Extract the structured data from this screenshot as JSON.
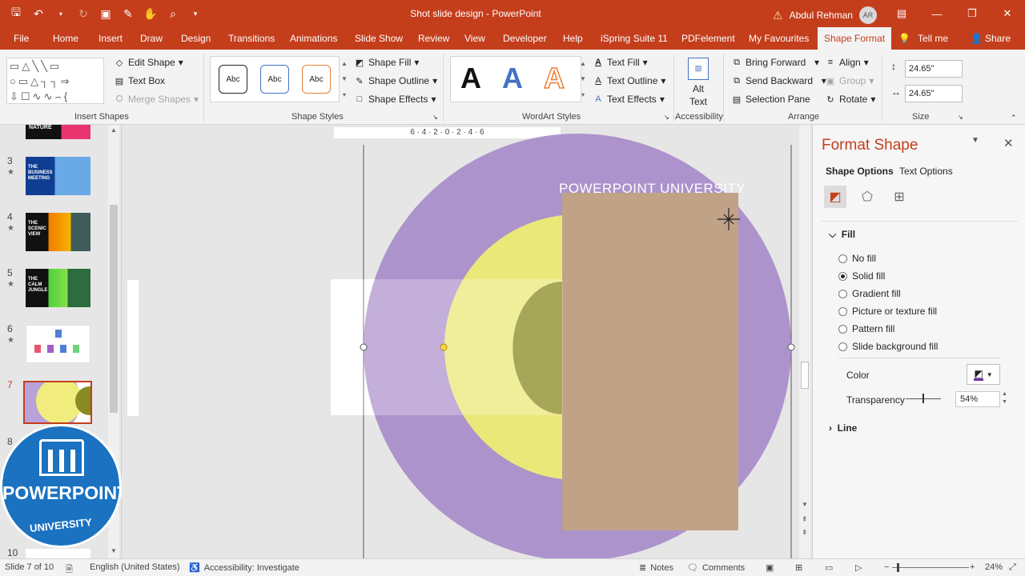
{
  "app": {
    "title": "Shot slide design  -  PowerPoint",
    "user_name": "Abdul Rehman",
    "user_initials": "AR",
    "accent": "#c43e1c"
  },
  "tabs": [
    "File",
    "Home",
    "Insert",
    "Draw",
    "Design",
    "Transitions",
    "Animations",
    "Slide Show",
    "Review",
    "View",
    "Developer",
    "Help",
    "iSpring Suite 11",
    "PDFelement",
    "My Favourites",
    "Shape Format",
    "Tell me",
    "Share"
  ],
  "ribbon": {
    "insert_shapes": {
      "label": "Insert Shapes",
      "edit_shape": "Edit Shape",
      "text_box": "Text Box",
      "merge_shapes": "Merge Shapes"
    },
    "shape_styles": {
      "label": "Shape Styles",
      "sample": "Abc",
      "fill": "Shape Fill",
      "outline": "Shape Outline",
      "effects": "Shape Effects"
    },
    "wordart_styles": {
      "label": "WordArt Styles",
      "sample": "A",
      "text_fill": "Text Fill",
      "text_outline": "Text Outline",
      "text_effects": "Text Effects"
    },
    "accessibility": {
      "label": "Accessibility",
      "alt_text_1": "Alt",
      "alt_text_2": "Text"
    },
    "arrange": {
      "label": "Arrange",
      "bring_forward": "Bring Forward",
      "send_backward": "Send Backward",
      "selection_pane": "Selection Pane",
      "align": "Align",
      "group": "Group",
      "rotate": "Rotate"
    },
    "size": {
      "label": "Size",
      "height": "24.65\"",
      "width": "24.65\""
    }
  },
  "slides": {
    "numbers": [
      "3",
      "4",
      "5",
      "6",
      "7",
      "8",
      "10"
    ],
    "thumb_titles": [
      "THE BUSINESS MEETING",
      "THE SCENIC VIEW",
      "THE CALM JUNGLE"
    ],
    "top_thumb_text": "NATURE"
  },
  "slide": {
    "watermark": "POWERPOINT UNIVERSITY",
    "ruler_h": "6 · 4 · 2 · 0 · 2 · 4 · 6",
    "colors": {
      "purple": "#a68ac8",
      "yellow": "#ebe87a",
      "olive": "#8a8a23",
      "tan": "#b8958a"
    }
  },
  "logo": {
    "title": "POWERPOINT",
    "subtitle": "UNIVERSITY"
  },
  "format_pane": {
    "title": "Format Shape",
    "shape_options": "Shape Options",
    "text_options": "Text Options",
    "fill_section": "Fill",
    "fill_options": [
      "No fill",
      "Solid fill",
      "Gradient fill",
      "Picture or texture fill",
      "Pattern fill",
      "Slide background fill"
    ],
    "selected_fill": "Solid fill",
    "color_label": "Color",
    "transparency_label": "Transparency",
    "transparency_value": "54%",
    "transparency_fraction": 0.54,
    "line_section": "Line"
  },
  "status": {
    "slide_info": "Slide 7 of 10",
    "language": "English (United States)",
    "accessibility": "Accessibility: Investigate",
    "notes": "Notes",
    "comments": "Comments",
    "zoom": "24%"
  }
}
